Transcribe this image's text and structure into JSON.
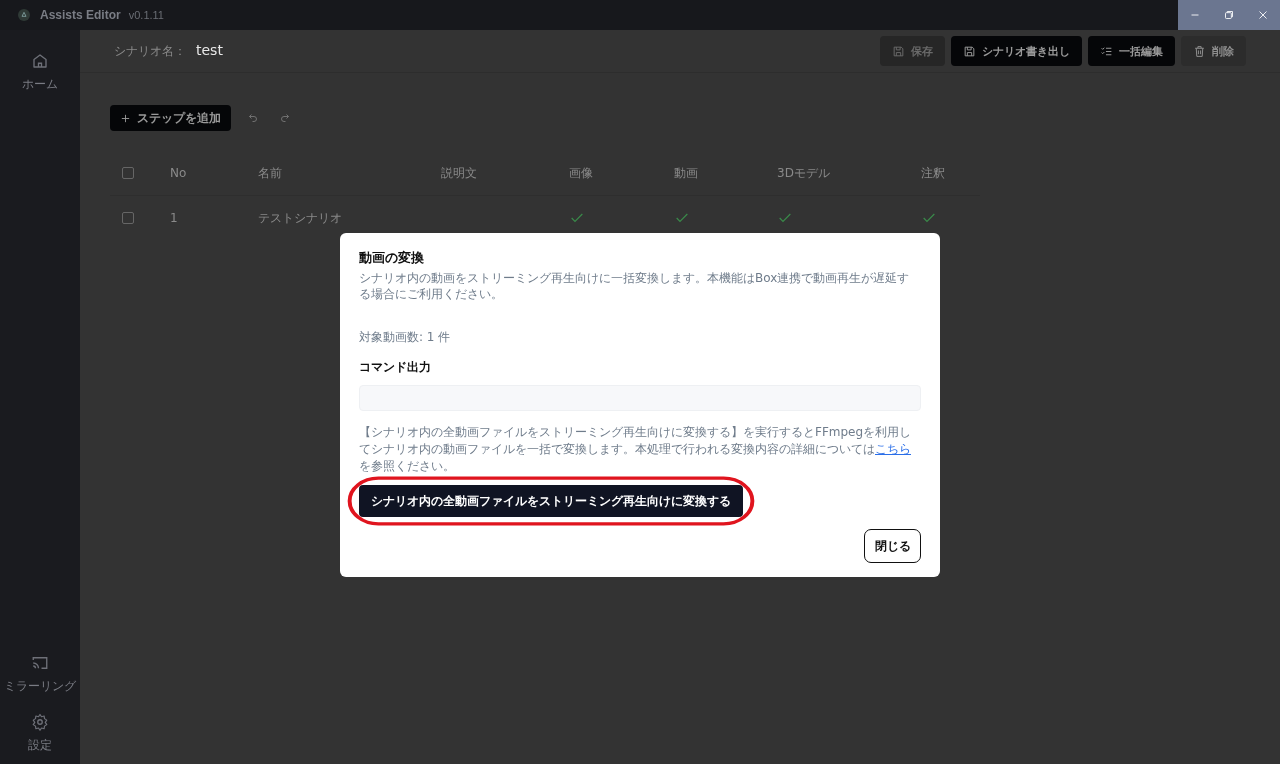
{
  "title_bar": {
    "app_name": "Assists Editor",
    "version": "v0.1.11"
  },
  "sidebar": {
    "top_items": [
      {
        "label": "ホーム"
      }
    ],
    "bottom_items": [
      {
        "label": "ミラーリング"
      },
      {
        "label": "設定"
      }
    ]
  },
  "header": {
    "label": "シナリオ名：",
    "value": "test",
    "buttons": [
      {
        "label": "保存",
        "kind": "primary",
        "disabled": true
      },
      {
        "label": "シナリオ書き出し",
        "kind": "primary",
        "disabled": false
      },
      {
        "label": "一括編集",
        "kind": "primary",
        "disabled": false
      },
      {
        "label": "削除",
        "kind": "ghost",
        "disabled": false
      }
    ]
  },
  "toolbar": {
    "add_button": "ステップを追加"
  },
  "table": {
    "select_all_checked": false,
    "columns": [
      "No",
      "名前",
      "説明文",
      "画像",
      "動画",
      "3Dモデル",
      "注釈"
    ],
    "rows": [
      {
        "checked": false,
        "cells": [
          {
            "kind": "text",
            "text": "1"
          },
          {
            "kind": "text",
            "text": "テストシナリオ"
          },
          {
            "kind": "text",
            "text": ""
          },
          {
            "kind": "check",
            "on": true
          },
          {
            "kind": "check",
            "on": true
          },
          {
            "kind": "check",
            "on": true
          },
          {
            "kind": "check",
            "on": true
          }
        ]
      }
    ]
  },
  "dialog": {
    "title": "動画の変換",
    "description": "シナリオ内の動画をストリーミング再生向けに一括変換します。本機能はBox連携で動画再生が遅延する場合にご利用ください。",
    "count": "対象動画数: 1 件",
    "output_label": "コマンド出力",
    "note_before": "【シナリオ内の全動画ファイルをストリーミング再生向けに変換する】を実行するとFFmpegを利用してシナリオ内の動画ファイルを一括で変換します。本処理で行われる変換内容の詳細については",
    "note_link": "こちら",
    "note_after": "を参照ください。",
    "convert_button": {
      "label": "シナリオ内の全動画ファイルをストリーミング再生向けに変換する",
      "highlighted": true
    },
    "close_button": "閉じる"
  }
}
